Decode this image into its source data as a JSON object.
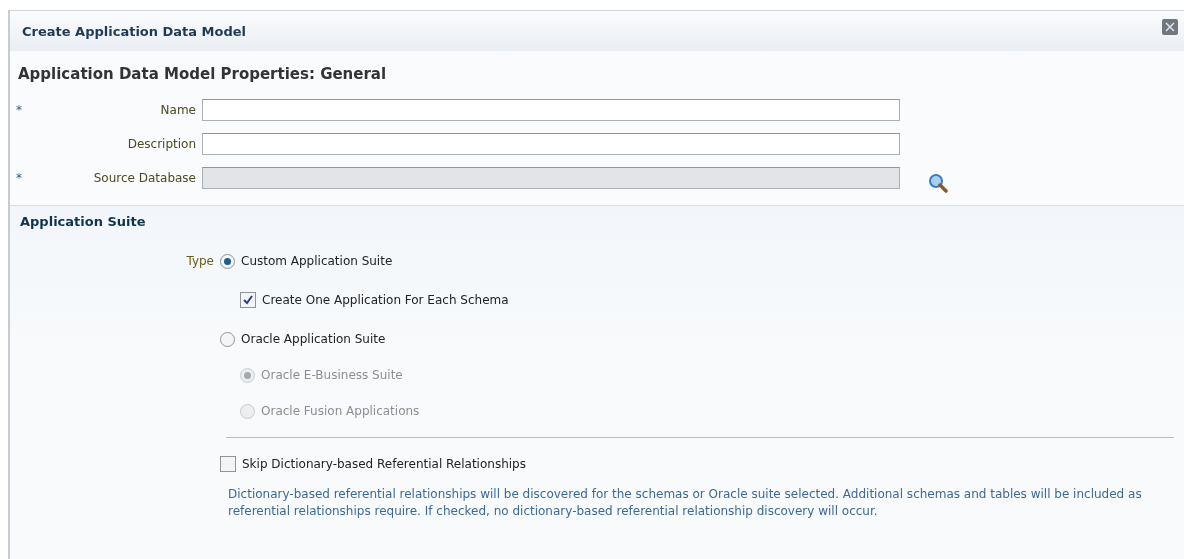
{
  "dialog": {
    "title": "Create Application Data Model"
  },
  "heading": "Application Data Model Properties: General",
  "fields": [
    {
      "marker": "*",
      "label": "Name",
      "disabled": false,
      "search": false
    },
    {
      "label": "Description",
      "disabled": false,
      "search": false
    },
    {
      "marker": "*",
      "label": "Source Database",
      "disabled": true,
      "search": true
    }
  ],
  "section": {
    "title": "Application Suite",
    "type_label": "Type",
    "options": [
      {
        "kind": "radio",
        "label": "Custom Application Suite",
        "selected": true,
        "disabled": false
      },
      {
        "kind": "checkbox",
        "label": "Create One Application For Each Schema",
        "checked": true,
        "disabled": false
      },
      {
        "kind": "radio",
        "label": "Oracle Application Suite",
        "selected": false,
        "disabled": false
      },
      {
        "kind": "subradio",
        "label": "Oracle E-Business Suite",
        "selected": true,
        "disabled": true
      },
      {
        "kind": "subradio",
        "label": "Oracle Fusion Applications",
        "selected": false,
        "disabled": true
      }
    ],
    "skip": {
      "label": "Skip Dictionary-based Referential Relationships",
      "checked": false
    },
    "help": "Dictionary-based referential relationships will be discovered for the schemas or Oracle suite selected. Additional schemas and tables will be included as referential relationships require. If checked, no dictionary-based referential relationship discovery will occur."
  }
}
